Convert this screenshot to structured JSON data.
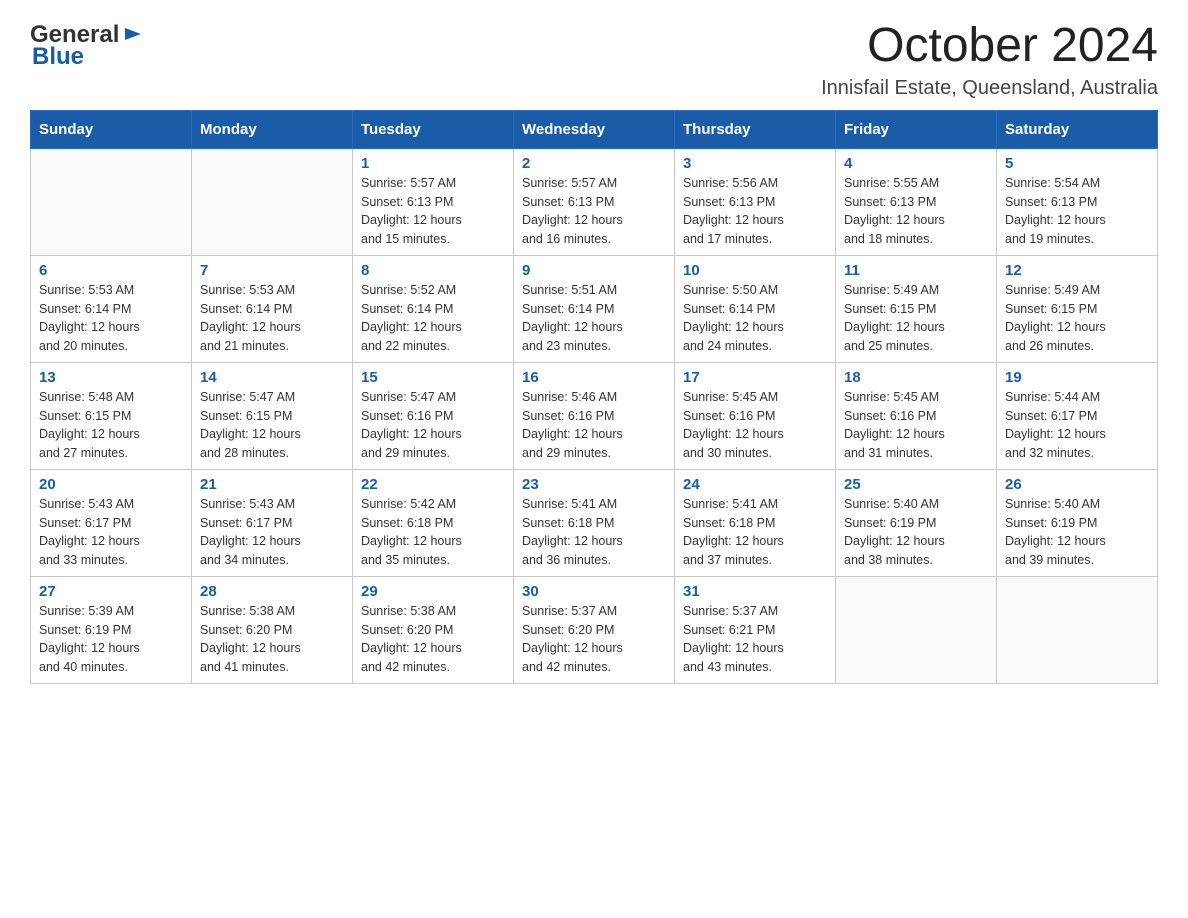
{
  "header": {
    "logo": {
      "general": "General",
      "blue": "Blue",
      "arrow": "▶"
    },
    "title": "October 2024",
    "subtitle": "Innisfail Estate, Queensland, Australia"
  },
  "calendar": {
    "days": [
      "Sunday",
      "Monday",
      "Tuesday",
      "Wednesday",
      "Thursday",
      "Friday",
      "Saturday"
    ],
    "weeks": [
      [
        {
          "day": "",
          "info": ""
        },
        {
          "day": "",
          "info": ""
        },
        {
          "day": "1",
          "info": "Sunrise: 5:57 AM\nSunset: 6:13 PM\nDaylight: 12 hours\nand 15 minutes."
        },
        {
          "day": "2",
          "info": "Sunrise: 5:57 AM\nSunset: 6:13 PM\nDaylight: 12 hours\nand 16 minutes."
        },
        {
          "day": "3",
          "info": "Sunrise: 5:56 AM\nSunset: 6:13 PM\nDaylight: 12 hours\nand 17 minutes."
        },
        {
          "day": "4",
          "info": "Sunrise: 5:55 AM\nSunset: 6:13 PM\nDaylight: 12 hours\nand 18 minutes."
        },
        {
          "day": "5",
          "info": "Sunrise: 5:54 AM\nSunset: 6:13 PM\nDaylight: 12 hours\nand 19 minutes."
        }
      ],
      [
        {
          "day": "6",
          "info": "Sunrise: 5:53 AM\nSunset: 6:14 PM\nDaylight: 12 hours\nand 20 minutes."
        },
        {
          "day": "7",
          "info": "Sunrise: 5:53 AM\nSunset: 6:14 PM\nDaylight: 12 hours\nand 21 minutes."
        },
        {
          "day": "8",
          "info": "Sunrise: 5:52 AM\nSunset: 6:14 PM\nDaylight: 12 hours\nand 22 minutes."
        },
        {
          "day": "9",
          "info": "Sunrise: 5:51 AM\nSunset: 6:14 PM\nDaylight: 12 hours\nand 23 minutes."
        },
        {
          "day": "10",
          "info": "Sunrise: 5:50 AM\nSunset: 6:14 PM\nDaylight: 12 hours\nand 24 minutes."
        },
        {
          "day": "11",
          "info": "Sunrise: 5:49 AM\nSunset: 6:15 PM\nDaylight: 12 hours\nand 25 minutes."
        },
        {
          "day": "12",
          "info": "Sunrise: 5:49 AM\nSunset: 6:15 PM\nDaylight: 12 hours\nand 26 minutes."
        }
      ],
      [
        {
          "day": "13",
          "info": "Sunrise: 5:48 AM\nSunset: 6:15 PM\nDaylight: 12 hours\nand 27 minutes."
        },
        {
          "day": "14",
          "info": "Sunrise: 5:47 AM\nSunset: 6:15 PM\nDaylight: 12 hours\nand 28 minutes."
        },
        {
          "day": "15",
          "info": "Sunrise: 5:47 AM\nSunset: 6:16 PM\nDaylight: 12 hours\nand 29 minutes."
        },
        {
          "day": "16",
          "info": "Sunrise: 5:46 AM\nSunset: 6:16 PM\nDaylight: 12 hours\nand 29 minutes."
        },
        {
          "day": "17",
          "info": "Sunrise: 5:45 AM\nSunset: 6:16 PM\nDaylight: 12 hours\nand 30 minutes."
        },
        {
          "day": "18",
          "info": "Sunrise: 5:45 AM\nSunset: 6:16 PM\nDaylight: 12 hours\nand 31 minutes."
        },
        {
          "day": "19",
          "info": "Sunrise: 5:44 AM\nSunset: 6:17 PM\nDaylight: 12 hours\nand 32 minutes."
        }
      ],
      [
        {
          "day": "20",
          "info": "Sunrise: 5:43 AM\nSunset: 6:17 PM\nDaylight: 12 hours\nand 33 minutes."
        },
        {
          "day": "21",
          "info": "Sunrise: 5:43 AM\nSunset: 6:17 PM\nDaylight: 12 hours\nand 34 minutes."
        },
        {
          "day": "22",
          "info": "Sunrise: 5:42 AM\nSunset: 6:18 PM\nDaylight: 12 hours\nand 35 minutes."
        },
        {
          "day": "23",
          "info": "Sunrise: 5:41 AM\nSunset: 6:18 PM\nDaylight: 12 hours\nand 36 minutes."
        },
        {
          "day": "24",
          "info": "Sunrise: 5:41 AM\nSunset: 6:18 PM\nDaylight: 12 hours\nand 37 minutes."
        },
        {
          "day": "25",
          "info": "Sunrise: 5:40 AM\nSunset: 6:19 PM\nDaylight: 12 hours\nand 38 minutes."
        },
        {
          "day": "26",
          "info": "Sunrise: 5:40 AM\nSunset: 6:19 PM\nDaylight: 12 hours\nand 39 minutes."
        }
      ],
      [
        {
          "day": "27",
          "info": "Sunrise: 5:39 AM\nSunset: 6:19 PM\nDaylight: 12 hours\nand 40 minutes."
        },
        {
          "day": "28",
          "info": "Sunrise: 5:38 AM\nSunset: 6:20 PM\nDaylight: 12 hours\nand 41 minutes."
        },
        {
          "day": "29",
          "info": "Sunrise: 5:38 AM\nSunset: 6:20 PM\nDaylight: 12 hours\nand 42 minutes."
        },
        {
          "day": "30",
          "info": "Sunrise: 5:37 AM\nSunset: 6:20 PM\nDaylight: 12 hours\nand 42 minutes."
        },
        {
          "day": "31",
          "info": "Sunrise: 5:37 AM\nSunset: 6:21 PM\nDaylight: 12 hours\nand 43 minutes."
        },
        {
          "day": "",
          "info": ""
        },
        {
          "day": "",
          "info": ""
        }
      ]
    ]
  }
}
